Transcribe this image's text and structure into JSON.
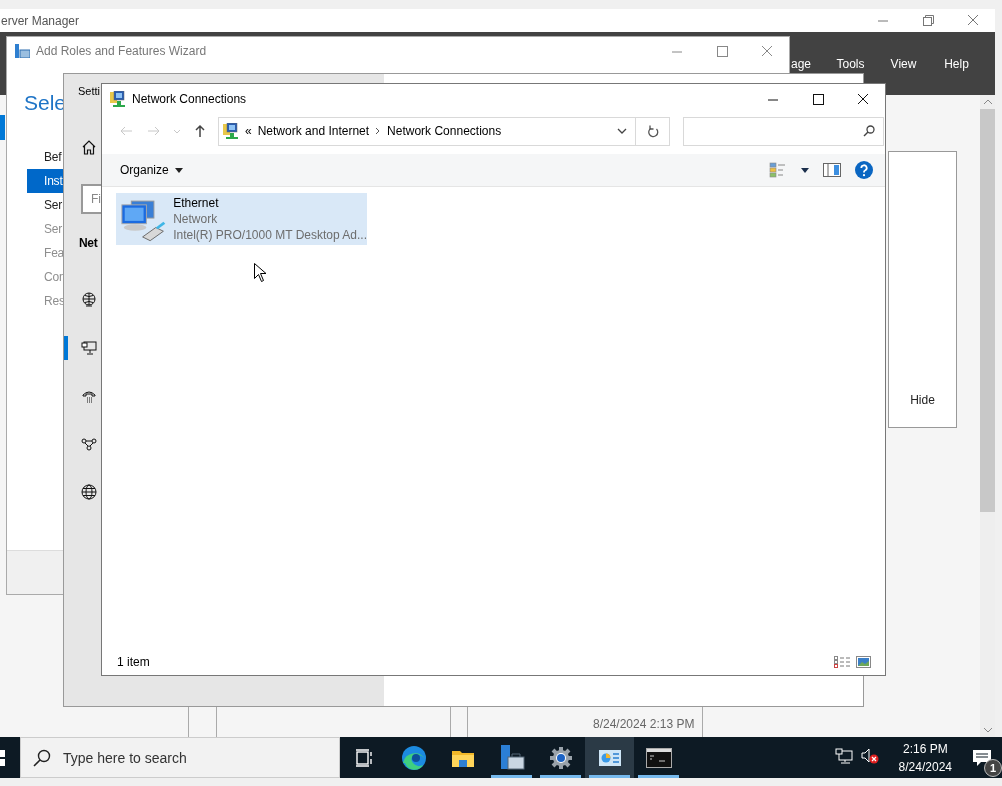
{
  "server_manager": {
    "title": "erver Manager",
    "menu": [
      {
        "label": "age"
      },
      {
        "label": "Tools"
      },
      {
        "label": "View"
      },
      {
        "label": "Help"
      }
    ],
    "hide_label": "Hide",
    "event_time": "8/24/2024 2:13 PM"
  },
  "wizard": {
    "title": "Add Roles and Features Wizard",
    "heading": "Sele",
    "steps": [
      {
        "label": "Bef",
        "selected": false,
        "disabled": false
      },
      {
        "label": "Inst",
        "selected": true,
        "disabled": false
      },
      {
        "label": "Ser",
        "selected": false,
        "disabled": false
      },
      {
        "label": "Ser",
        "selected": false,
        "disabled": true
      },
      {
        "label": "Fea",
        "selected": false,
        "disabled": true
      },
      {
        "label": "Con",
        "selected": false,
        "disabled": true
      },
      {
        "label": "Res",
        "selected": false,
        "disabled": true
      }
    ]
  },
  "settings": {
    "title": "Setti",
    "search_placeholder": "Fi",
    "section": "Net",
    "nav": [
      {
        "kind": "status",
        "selected": false
      },
      {
        "kind": "ethernet",
        "selected": true
      },
      {
        "kind": "dialup",
        "selected": false
      },
      {
        "kind": "vpn",
        "selected": false
      },
      {
        "kind": "proxy",
        "selected": false
      }
    ]
  },
  "network_connections": {
    "title": "Network Connections",
    "nav_buttons": [
      {
        "kind": "back",
        "disabled": true
      },
      {
        "kind": "forward",
        "disabled": true
      },
      {
        "kind": "recent",
        "disabled": true
      },
      {
        "kind": "up",
        "disabled": false
      }
    ],
    "breadcrumb_overflow": "«",
    "breadcrumb": [
      "Network and Internet",
      "Network Connections"
    ],
    "organize": "Organize",
    "items": [
      {
        "name": "Ethernet",
        "status": "Network",
        "device": "Intel(R) PRO/1000 MT Desktop Ad...",
        "selected": true
      }
    ],
    "status_bar": "1 item"
  },
  "taskbar": {
    "search_placeholder": "Type here to search",
    "apps": [
      {
        "kind": "task-view",
        "running": false,
        "selected": false
      },
      {
        "kind": "edge",
        "running": false,
        "selected": false
      },
      {
        "kind": "explorer",
        "running": false,
        "selected": false
      },
      {
        "kind": "server-manager",
        "running": true,
        "selected": false
      },
      {
        "kind": "settings",
        "running": true,
        "selected": false
      },
      {
        "kind": "network",
        "running": true,
        "selected": true
      },
      {
        "kind": "cmd",
        "running": true,
        "selected": false
      }
    ],
    "time": "2:16 PM",
    "date": "8/24/2024",
    "notifications": "1"
  }
}
